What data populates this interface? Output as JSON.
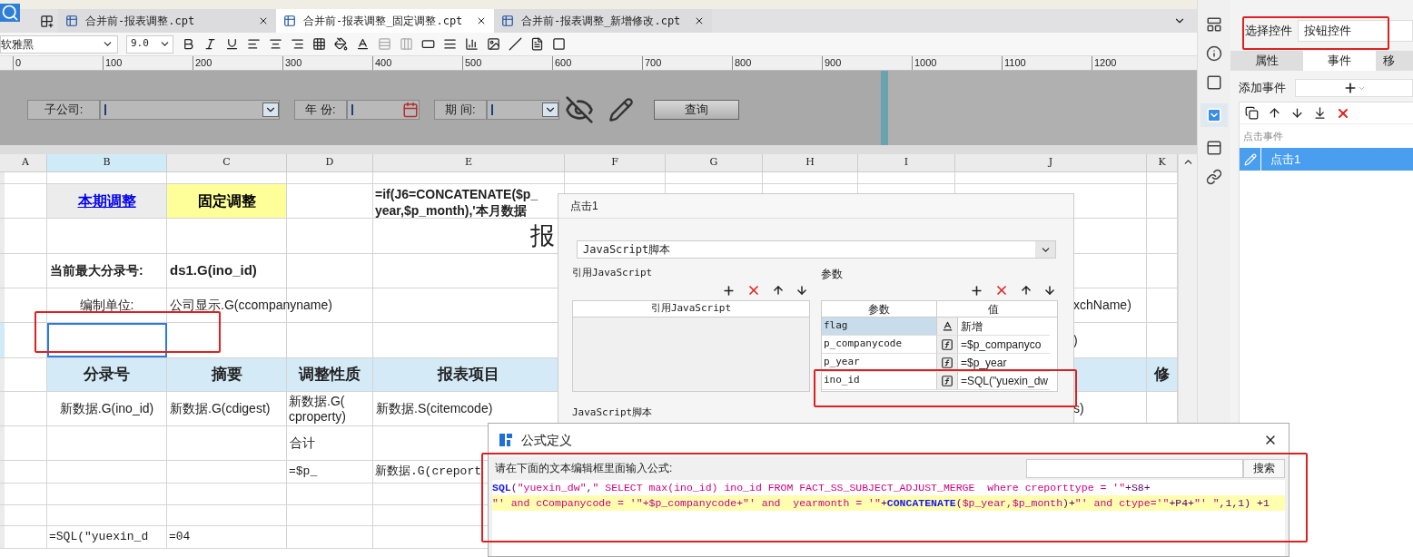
{
  "tabs": [
    {
      "label": "合并前-报表调整.cpt",
      "selected": false
    },
    {
      "label": "合并前-报表调整_固定调整.cpt",
      "selected": true
    },
    {
      "label": "合并前-报表调整_新增修改.cpt",
      "selected": false
    }
  ],
  "format_bar": {
    "font": "软雅黑",
    "size": "9.0"
  },
  "ruler": {
    "ticks": [
      "0",
      "100",
      "200",
      "300",
      "400",
      "500",
      "600",
      "700",
      "800",
      "900",
      "1000",
      "1100",
      "1200"
    ]
  },
  "parameters": [
    {
      "label": "子公司:",
      "kind": "combo"
    },
    {
      "label": "年 份:",
      "kind": "date"
    },
    {
      "label": "期 间:",
      "kind": "combo"
    }
  ],
  "query_button": "查询",
  "sheet": {
    "columns": [
      {
        "label": "A",
        "selected": false
      },
      {
        "label": "B",
        "selected": true
      },
      {
        "label": "C",
        "selected": false
      },
      {
        "label": "D",
        "selected": false
      },
      {
        "label": "E",
        "selected": false
      },
      {
        "label": "F",
        "selected": false
      },
      {
        "label": "G",
        "selected": false
      },
      {
        "label": "H",
        "selected": false
      },
      {
        "label": "I",
        "selected": false
      },
      {
        "label": "J",
        "selected": false
      },
      {
        "label": "K",
        "selected": false
      }
    ],
    "rows": [
      {
        "selected": false,
        "cells": [
          null,
          null,
          null,
          null,
          null,
          null,
          null,
          null,
          null,
          null,
          null
        ]
      },
      {
        "selected": false,
        "cells": [
          null,
          {
            "text": "本期调整",
            "kind": "link"
          },
          {
            "text": "固定调整",
            "kind": "yellow"
          },
          null,
          {
            "text": "=if(J6=CONCATENATE($p_\nyear,$p_month),'本月数据",
            "kind": "formula"
          },
          null,
          null,
          null,
          null,
          null,
          null
        ]
      },
      {
        "selected": false,
        "cells": [
          null,
          null,
          null,
          null,
          {
            "text": "报",
            "kind": "title"
          },
          null,
          null,
          null,
          null,
          null,
          null
        ]
      },
      {
        "selected": false,
        "cells": [
          null,
          {
            "text": "当前最大分录号:",
            "kind": "label"
          },
          {
            "text": "ds1.G(ino_id)",
            "kind": "bold"
          },
          null,
          null,
          null,
          null,
          null,
          null,
          null,
          null
        ]
      },
      {
        "selected": false,
        "cells": [
          null,
          {
            "text": "编制单位:",
            "kind": "center"
          },
          {
            "text": "公司显示.G(ccompanyname)",
            "kind": "plain"
          },
          null,
          null,
          null,
          null,
          null,
          null,
          {
            "text": "xchName)",
            "kind": "tail"
          },
          null
        ]
      },
      {
        "selected": true,
        "cells": [
          null,
          null,
          null,
          null,
          null,
          null,
          null,
          null,
          null,
          {
            "text": ")",
            "kind": "tail"
          },
          null
        ]
      },
      {
        "selected": false,
        "cells": [
          null,
          {
            "text": "分录号",
            "kind": "header"
          },
          {
            "text": "摘要",
            "kind": "header"
          },
          {
            "text": "调整性质",
            "kind": "header"
          },
          {
            "text": "报表项目",
            "kind": "header"
          },
          null,
          null,
          null,
          null,
          {
            "kind": "header"
          },
          {
            "text": "修",
            "kind": "header"
          }
        ]
      },
      {
        "selected": false,
        "cells": [
          null,
          {
            "text": "新数据.G(ino_id)",
            "kind": "center"
          },
          {
            "text": "新数据.G(cdigest)",
            "kind": "plain"
          },
          {
            "text": "新数据.G(\ncproperty)",
            "kind": "wrap"
          },
          {
            "text": "新数据.S(citemcode)",
            "kind": "plain"
          },
          null,
          null,
          null,
          null,
          {
            "text": "s)",
            "kind": "tail"
          },
          null
        ]
      },
      {
        "selected": false,
        "cells": [
          null,
          null,
          null,
          {
            "text": "合计",
            "kind": "plain"
          },
          null,
          null,
          null,
          null,
          null,
          null,
          null
        ]
      },
      {
        "selected": false,
        "cells": [
          null,
          null,
          null,
          {
            "text": "=$p_",
            "kind": "mono"
          },
          {
            "text": "新数据.G(creport",
            "kind": "mono"
          },
          null,
          null,
          null,
          null,
          null,
          null
        ]
      },
      {
        "selected": false,
        "cells": [
          null,
          null,
          null,
          null,
          null,
          null,
          null,
          null,
          null,
          null,
          null
        ]
      },
      {
        "selected": false,
        "cells": [
          null,
          null,
          null,
          null,
          null,
          null,
          null,
          null,
          null,
          null,
          null
        ]
      },
      {
        "selected": false,
        "cells": [
          null,
          {
            "text": "=SQL(\"yuexin_d",
            "kind": "mono"
          },
          {
            "text": "=04",
            "kind": "mono"
          },
          null,
          null,
          null,
          null,
          null,
          null,
          null,
          null
        ]
      }
    ]
  },
  "event_dialog": {
    "title": "点击1",
    "type_select": "JavaScript脚本",
    "ref_section": "引用JavaScript",
    "ref_column": "引用JavaScript",
    "param_section": "参数",
    "param_columns": [
      "参数",
      "值"
    ],
    "params": [
      {
        "name": "flag",
        "kind": "text",
        "value": "新增",
        "selected": true
      },
      {
        "name": "p_companycode",
        "kind": "formula",
        "value": "=$p_companyco",
        "selected": false
      },
      {
        "name": "p_year",
        "kind": "formula",
        "value": "=$p_year",
        "selected": false
      },
      {
        "name": "ino_id",
        "kind": "formula",
        "value": "=SQL(\"yuexin_dw",
        "selected": false
      }
    ],
    "script_section": "JavaScript脚本"
  },
  "formula_dialog": {
    "title": "公式定义",
    "prompt": "请在下面的文本编辑框里面输入公式:",
    "search_button": "搜索",
    "lines": [
      {
        "highlighted": false,
        "tokens": [
          {
            "kind": "fn",
            "text": "SQL"
          },
          {
            "kind": "plain",
            "text": "("
          },
          {
            "kind": "str",
            "text": "\"yuexin_dw\""
          },
          {
            "kind": "plain",
            "text": ","
          },
          {
            "kind": "str",
            "text": "\" SELECT max(ino_id) ino_id FROM FACT_SS_SUBJECT_ADJUST_MERGE  where creporttype = '\""
          },
          {
            "kind": "plain",
            "text": "+S8+"
          }
        ]
      },
      {
        "highlighted": true,
        "tokens": [
          {
            "kind": "str",
            "text": "\"' and cCompanycode = '\""
          },
          {
            "kind": "var",
            "text": "+$p_companycode+"
          },
          {
            "kind": "str",
            "text": "\"' and  yearmonth = '\""
          },
          {
            "kind": "plain",
            "text": "+"
          },
          {
            "kind": "fn",
            "text": "CONCATENATE"
          },
          {
            "kind": "plain",
            "text": "("
          },
          {
            "kind": "var",
            "text": "$p_year,$p_month"
          },
          {
            "kind": "plain",
            "text": ")+"
          },
          {
            "kind": "str",
            "text": "\"' and ctype='\""
          },
          {
            "kind": "plain",
            "text": "+P4+"
          },
          {
            "kind": "str",
            "text": "\"' \""
          },
          {
            "kind": "plain",
            "text": ",1,1) +1"
          }
        ]
      }
    ]
  },
  "control_panel": {
    "select_label": "选择控件",
    "select_value": "按钮控件",
    "tabs": [
      {
        "label": "属性",
        "selected": false
      },
      {
        "label": "事件",
        "selected": true
      },
      {
        "label": "移",
        "selected": false
      }
    ],
    "add_event_label": "添加事件",
    "event_group": "点击事件",
    "events": [
      {
        "label": "点击1",
        "selected": true
      }
    ]
  }
}
